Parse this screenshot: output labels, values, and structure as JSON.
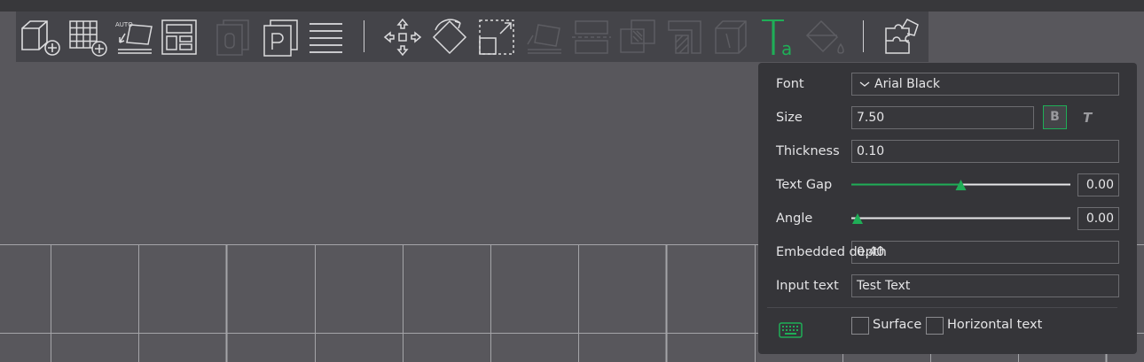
{
  "toolbar": {
    "tools": [
      {
        "name": "add-cube-icon",
        "enabled": true
      },
      {
        "name": "add-plate-icon",
        "enabled": true
      },
      {
        "name": "auto-orient-icon",
        "enabled": true,
        "badge": "AUTO"
      },
      {
        "name": "arrange-icon",
        "enabled": true
      },
      {
        "name": "split-objects-icon",
        "enabled": false
      },
      {
        "name": "split-parts-icon",
        "enabled": true
      },
      {
        "name": "layers-icon",
        "enabled": true
      },
      {
        "name": "move-icon",
        "enabled": true
      },
      {
        "name": "rotate-icon",
        "enabled": true
      },
      {
        "name": "scale-icon",
        "enabled": true
      },
      {
        "name": "lay-on-face-icon",
        "enabled": false
      },
      {
        "name": "cut-icon",
        "enabled": false
      },
      {
        "name": "boolean-icon",
        "enabled": false
      },
      {
        "name": "support-paint-icon",
        "enabled": false
      },
      {
        "name": "seam-paint-icon",
        "enabled": false
      },
      {
        "name": "text-tool-icon",
        "enabled": true,
        "active": true
      },
      {
        "name": "color-paint-icon",
        "enabled": false
      },
      {
        "name": "assembly-icon",
        "enabled": true
      }
    ]
  },
  "text_panel": {
    "font": {
      "label": "Font",
      "value": "Arial Black"
    },
    "size": {
      "label": "Size",
      "value": "7.50",
      "bold_label": "B",
      "italic_label": "T"
    },
    "thickness": {
      "label": "Thickness",
      "value": "0.10"
    },
    "text_gap": {
      "label": "Text Gap",
      "value": "0.00",
      "slider_fraction": 0.5
    },
    "angle": {
      "label": "Angle",
      "value": "0.00",
      "slider_fraction": 0.0
    },
    "embedded_depth": {
      "label": "Embedded depth",
      "value": "0.40"
    },
    "input_text": {
      "label": "Input text",
      "value": "Test Text"
    },
    "surface_label": "Surface",
    "horizontal_text_label": "Horizontal text"
  },
  "colors": {
    "accent": "#1fae57",
    "panel_bg": "#353539",
    "canvas_bg": "#58575c",
    "toolbar_bg": "#444449",
    "grid_line": "#a4a4a8"
  }
}
